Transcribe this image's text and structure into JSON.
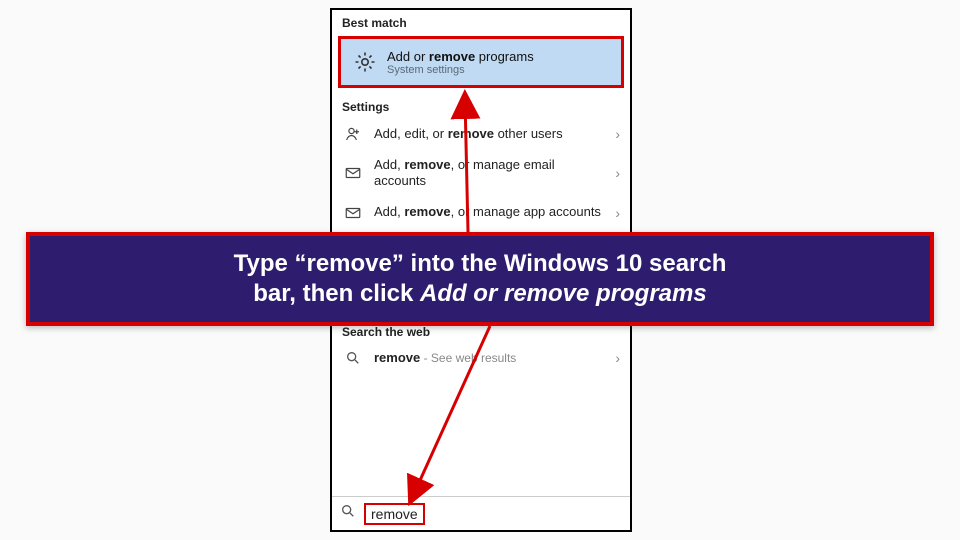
{
  "sections": {
    "best_match_header": "Best match",
    "settings_header": "Settings",
    "web_header": "Search the web"
  },
  "best_match": {
    "title_pre": "Add or ",
    "title_bold": "remove",
    "title_post": " programs",
    "subtitle": "System settings"
  },
  "settings_items": [
    {
      "pre": "Add, edit, or ",
      "bold": "remove",
      "post": " other users"
    },
    {
      "pre": "Add, ",
      "bold": "remove",
      "post": ", or manage email accounts"
    },
    {
      "pre": "Add, ",
      "bold": "remove",
      "post": ", or manage app accounts"
    }
  ],
  "web": {
    "term": "remove",
    "hint": " - See web results"
  },
  "search": {
    "value": "remove"
  },
  "instruction": {
    "line1": "Type “remove” into the Windows 10 search",
    "line2a": "bar, then click ",
    "line2b": "Add or remove programs"
  },
  "colors": {
    "highlight": "#d60000",
    "banner_bg": "#2e1d6e"
  }
}
